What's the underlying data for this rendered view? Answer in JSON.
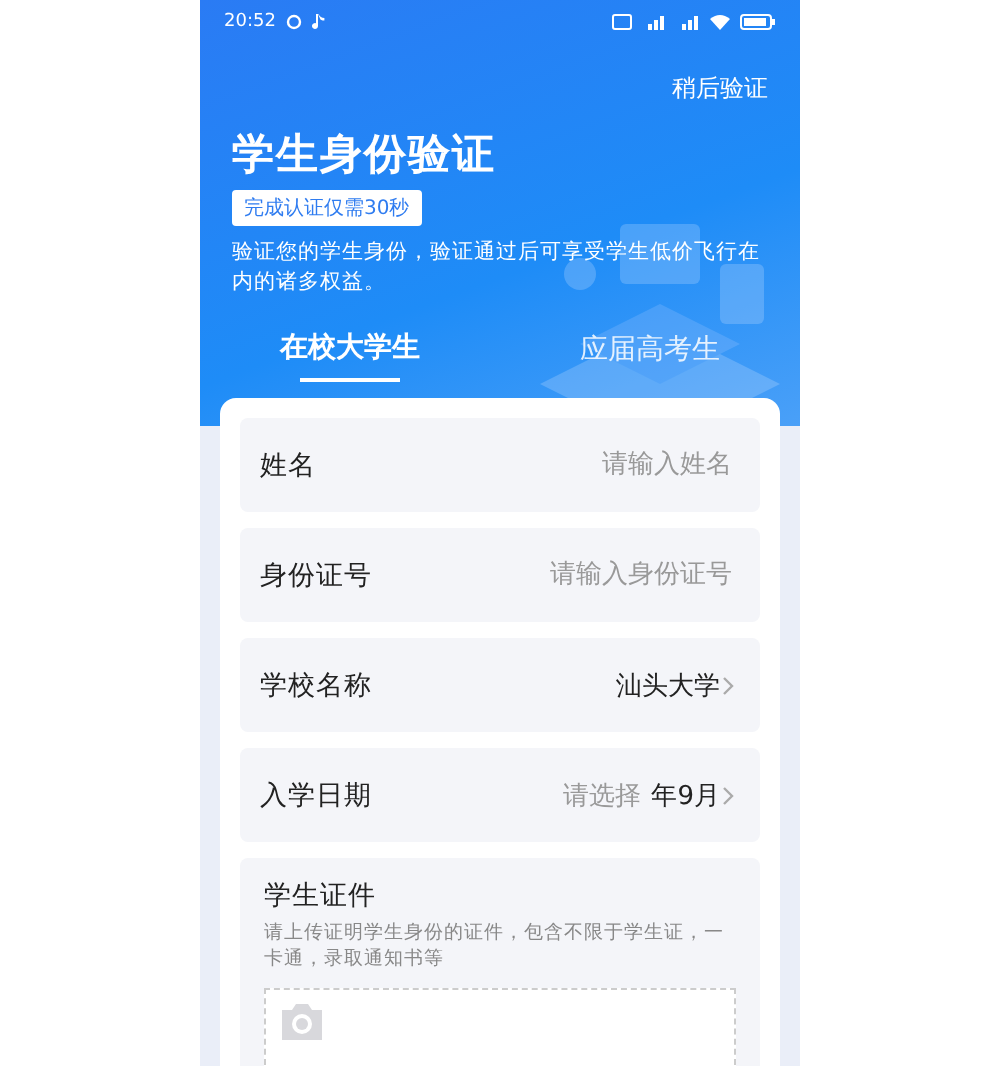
{
  "status_bar": {
    "time": "20:52"
  },
  "header": {
    "skip_link": "稍后验证",
    "title": "学生身份验证",
    "badge": "完成认证仅需30秒",
    "description": "验证您的学生身份，验证通过后可享受学生低价飞行在内的诸多权益。"
  },
  "tabs": [
    {
      "label": "在校大学生",
      "selected": true
    },
    {
      "label": "应届高考生",
      "selected": false
    }
  ],
  "fields": [
    {
      "kind": "input",
      "label": "姓名",
      "placeholder": "请输入姓名"
    },
    {
      "kind": "input",
      "label": "身份证号",
      "placeholder": "请输入身份证号"
    },
    {
      "kind": "select",
      "label": "学校名称",
      "value": "汕头大学"
    },
    {
      "kind": "date",
      "label": "入学日期",
      "placeholder": "请选择",
      "value": "年9月"
    }
  ],
  "upload": {
    "title": "学生证件",
    "hint": "请上传证明学生身份的证件，包含不限于学生证，一卡通，录取通知书等"
  }
}
